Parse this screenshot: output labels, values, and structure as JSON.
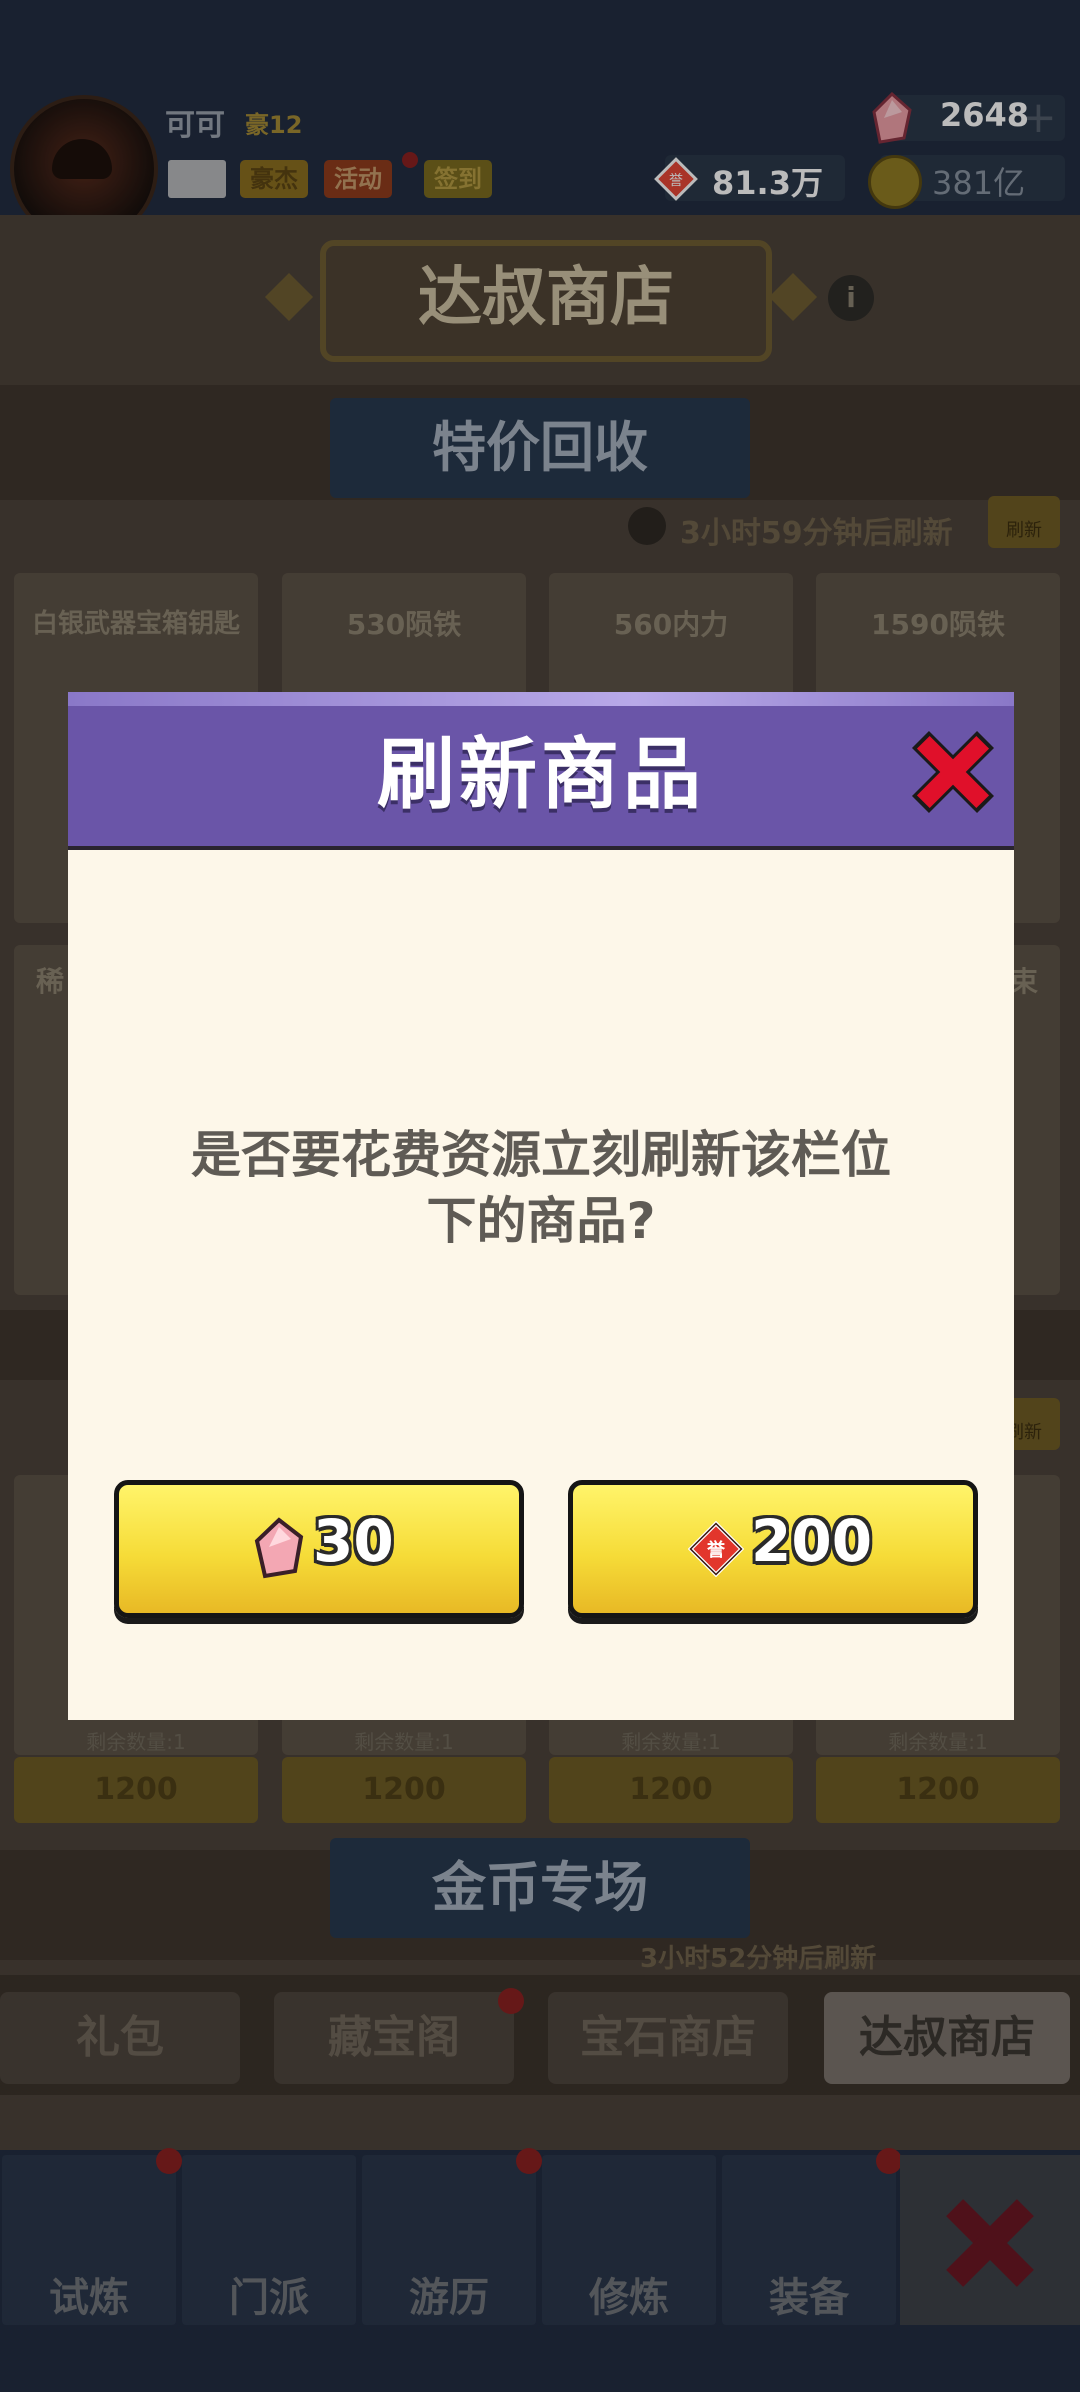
{
  "header": {
    "username": "可可",
    "vip_level": "豪12",
    "tags": [
      "豪杰",
      "活动",
      "签到"
    ],
    "gems": "2648",
    "honor_points": "81.3万",
    "gold": "381亿"
  },
  "shop": {
    "title": "达叔商店",
    "section_special": "特价回收",
    "refresh_timer": "3小时59分钟后刷新",
    "refresh_label": "刷新",
    "items_row1": [
      "白银武器宝箱钥匙",
      "530陨铁",
      "560内力",
      "1590陨铁"
    ],
    "row2_left_fragment": "稀",
    "row2_right_fragment": "束",
    "remaining_label": "剩余数量:1",
    "item_price": "1200",
    "section_gold": "金币专场",
    "gold_timer": "3小时52分钟后刷新"
  },
  "tabs": [
    "礼包",
    "藏宝阁",
    "宝石商店",
    "达叔商店"
  ],
  "active_tab": "达叔商店",
  "bottom_nav": [
    "试炼",
    "门派",
    "游历",
    "修炼",
    "装备"
  ],
  "dialog": {
    "title": "刷新商品",
    "message_line1": "是否要花费资源立刻刷新该栏位",
    "message_line2": "下的商品?",
    "gem_cost": "30",
    "honor_cost": "200"
  },
  "colors": {
    "dialog_header": "#6a55a8",
    "dialog_body": "#fdf7e9",
    "button_yellow": "#f6dc38",
    "close_red": "#e0102a"
  }
}
